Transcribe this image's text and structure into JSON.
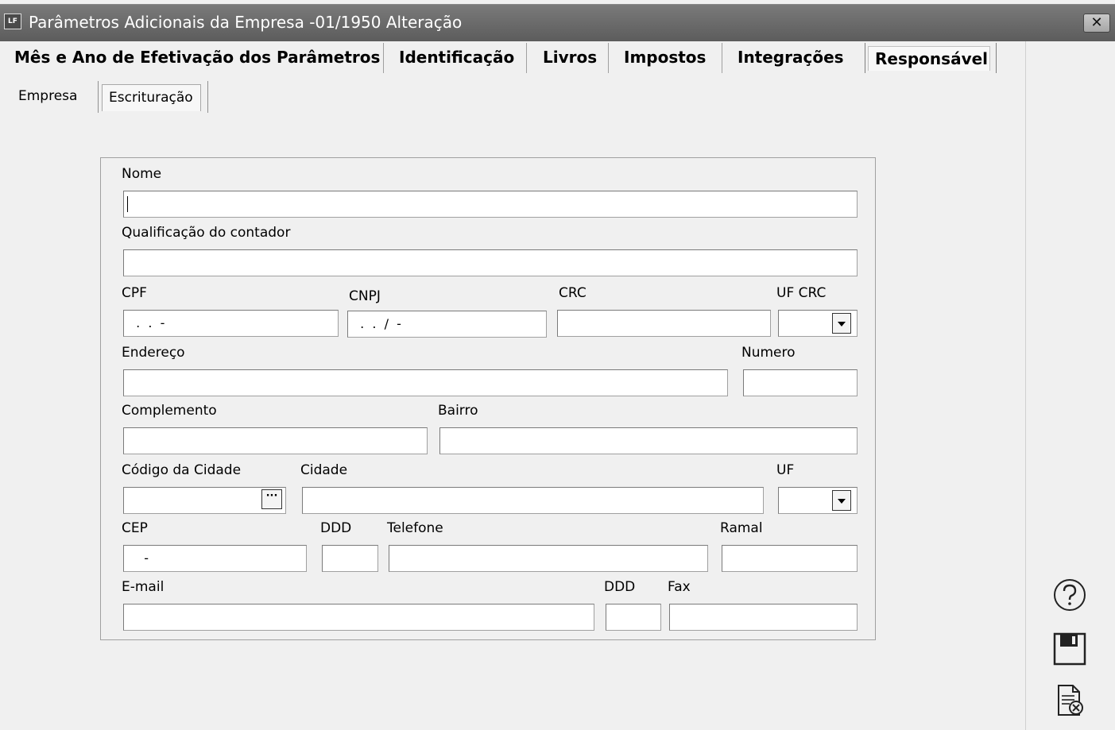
{
  "window": {
    "title": "Parâmetros Adicionais da Empresa -01/1950 Alteração",
    "app_icon_text": "LF",
    "close_glyph": "✕"
  },
  "tabs": [
    {
      "label": "Mês e Ano de Efetivação dos Parâmetros",
      "active": false
    },
    {
      "label": "Identificação",
      "active": false
    },
    {
      "label": "Livros",
      "active": false
    },
    {
      "label": "Impostos",
      "active": false
    },
    {
      "label": "Integrações",
      "active": false
    },
    {
      "label": "Responsável",
      "active": true
    }
  ],
  "subtabs": [
    {
      "label": "Empresa",
      "active": false
    },
    {
      "label": "Escrituração",
      "active": true
    }
  ],
  "form": {
    "nome": {
      "label": "Nome",
      "value": ""
    },
    "qualificacao": {
      "label": "Qualificação do contador",
      "value": ""
    },
    "cpf": {
      "label": "CPF",
      "value": " .  .  -"
    },
    "cnpj": {
      "label": "CNPJ",
      "value": " .  .  /  -"
    },
    "crc": {
      "label": "CRC",
      "value": ""
    },
    "uf_crc": {
      "label": "UF CRC",
      "value": ""
    },
    "endereco": {
      "label": "Endereço",
      "value": ""
    },
    "numero": {
      "label": "Numero",
      "value": ""
    },
    "complemento": {
      "label": "Complemento",
      "value": ""
    },
    "bairro": {
      "label": "Bairro",
      "value": ""
    },
    "codigo_cidade": {
      "label": "Código da Cidade",
      "value": "",
      "button_text": "···"
    },
    "cidade": {
      "label": "Cidade",
      "value": ""
    },
    "uf": {
      "label": "UF",
      "value": ""
    },
    "cep": {
      "label": "CEP",
      "value": "   -"
    },
    "ddd": {
      "label": "DDD",
      "value": ""
    },
    "telefone": {
      "label": "Telefone",
      "value": ""
    },
    "ramal": {
      "label": "Ramal",
      "value": ""
    },
    "email": {
      "label": "E-mail",
      "value": ""
    },
    "ddd_fax": {
      "label": "DDD",
      "value": ""
    },
    "fax": {
      "label": "Fax",
      "value": ""
    }
  },
  "side_icons": [
    "help-icon",
    "save-icon",
    "cancel-document-icon"
  ]
}
